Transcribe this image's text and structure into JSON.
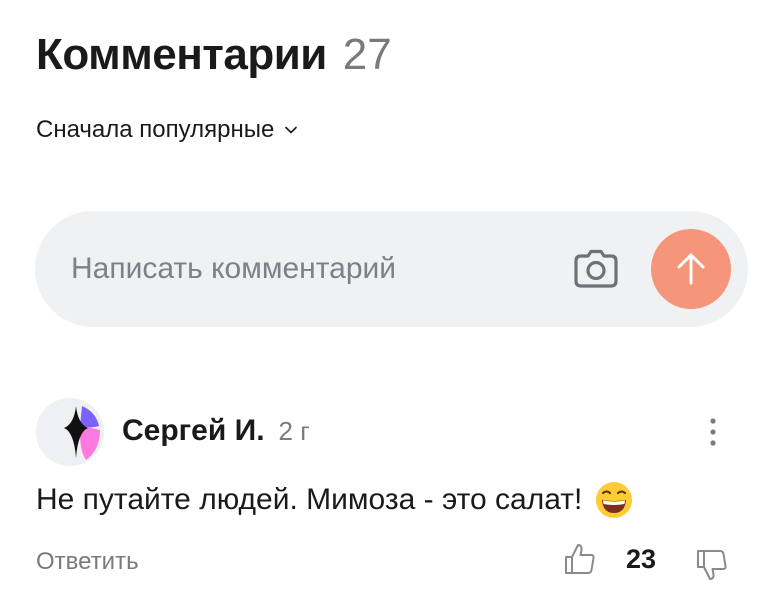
{
  "comments_section": {
    "title": "Комментарии",
    "count": "27",
    "sort_label": "Сначала популярные"
  },
  "composer": {
    "placeholder": "Написать комментарий",
    "camera_icon": "camera-icon",
    "send_icon": "arrow-up-icon",
    "send_color": "#f5957a"
  },
  "comment": {
    "author": "Сергей И.",
    "time": "2 г",
    "text": "Не путайте людей. Мимоза - это салат!",
    "emoji_icon": "grinning-face-emoji",
    "reply_label": "Ответить",
    "likes": "23",
    "like_icon": "thumbs-up-icon",
    "dislike_icon": "thumbs-down-icon",
    "more_icon": "vertical-dots-icon"
  }
}
